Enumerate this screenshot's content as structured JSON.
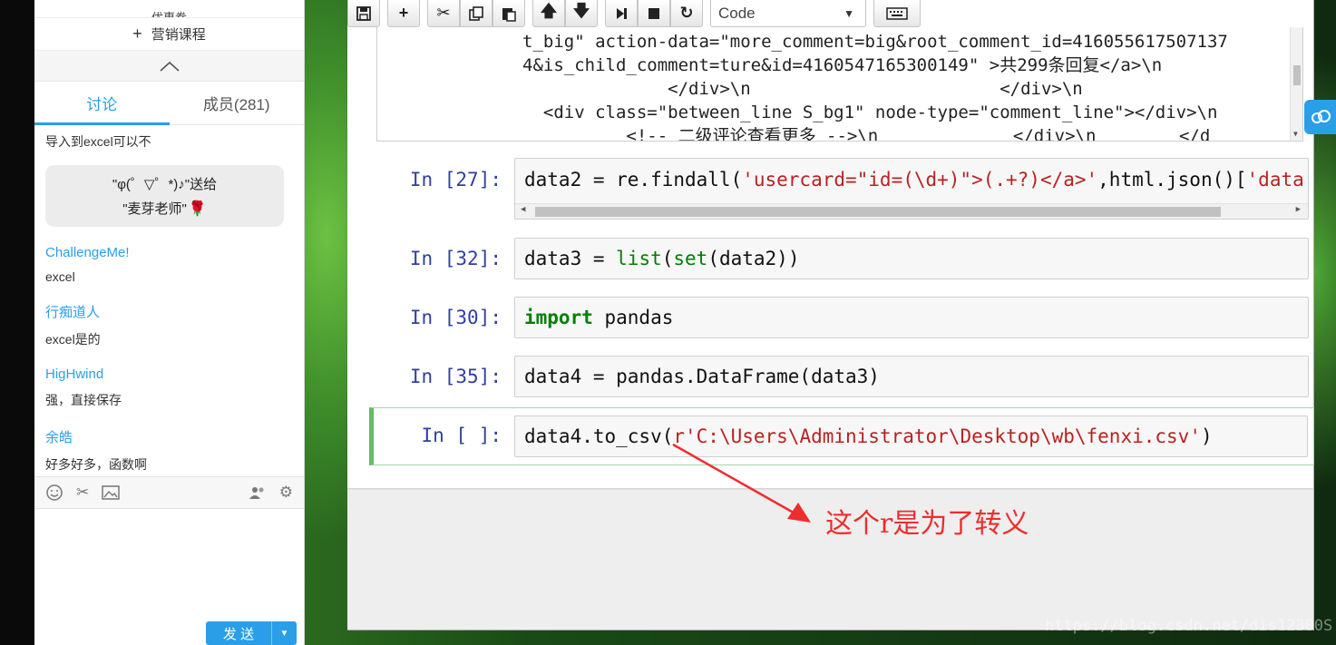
{
  "chat": {
    "top_partial": "优惠劵",
    "course_label": "营销课程",
    "tabs": [
      {
        "label": "讨论",
        "active": true
      },
      {
        "label": "成员(281)",
        "active": false
      }
    ],
    "messages": {
      "first_text": "导入到excel可以不",
      "gift_line1": "\"φ(゜▽゜*)♪\"送给",
      "gift_line2": "\"麦芽老师\"",
      "items": [
        {
          "user": "ChallengeMe!",
          "text": "excel"
        },
        {
          "user": "行痴道人",
          "text": "excel是的"
        },
        {
          "user": "HigHwind",
          "text": "强，直接保存"
        },
        {
          "user": "余皓",
          "text": "好多好多，函数啊"
        }
      ]
    },
    "toolbar_icons": [
      "emoji-icon",
      "scissors-icon",
      "image-icon",
      "members-icon",
      "settings-icon"
    ],
    "send_label": "发 送"
  },
  "notebook": {
    "cell_type": "Code",
    "output_lines": [
      "t_big\" action-data=\"more_comment=big&root_comment_id=416055617507137",
      "4&is_child_comment=ture&id=4160547165300149\" >共299条回复</a>\\n",
      "              </div>\\n                        </div>\\n",
      "  <div class=\"between_line S_bg1\" node-type=\"comment_line\"></div>\\n",
      "          <!-- 二级评论查看更多 -->\\n             </div>\\n        </d"
    ],
    "cells": [
      {
        "prompt": "In [27]:",
        "code_a": "data2 = re.findall(",
        "code_str1": "'usercard=\"id=(\\d+)\">(.+?)</a>'",
        "code_b": ",html.json()[",
        "code_str2": "'data'",
        "code_c": "]['"
      },
      {
        "prompt": "In [32]:",
        "code_a": "data3 = ",
        "code_bi1": "list",
        "code_b": "(",
        "code_bi2": "set",
        "code_c": "(data2))"
      },
      {
        "prompt": "In [30]:",
        "code_kw": "import",
        "code_b": " pandas"
      },
      {
        "prompt": "In [35]:",
        "code_a": "data4 = pandas.DataFrame(data3)"
      },
      {
        "prompt": "In [ ]:",
        "code_a": "data4.to_csv(",
        "code_str": "r'C:\\Users\\Administrator\\Desktop\\wb\\fenxi.csv'",
        "code_c": ")"
      }
    ],
    "annotation": "这个r是为了转义"
  },
  "watermark": "https://blog.csdn.net/dis12300S",
  "colors": {
    "accent_blue": "#2b9ee8",
    "prompt_blue": "#303f9f",
    "keyword_green": "#008000",
    "string_red": "#ba2121",
    "annotation_red": "#ee2d2d",
    "selected_cell_green": "#66bb6a"
  }
}
